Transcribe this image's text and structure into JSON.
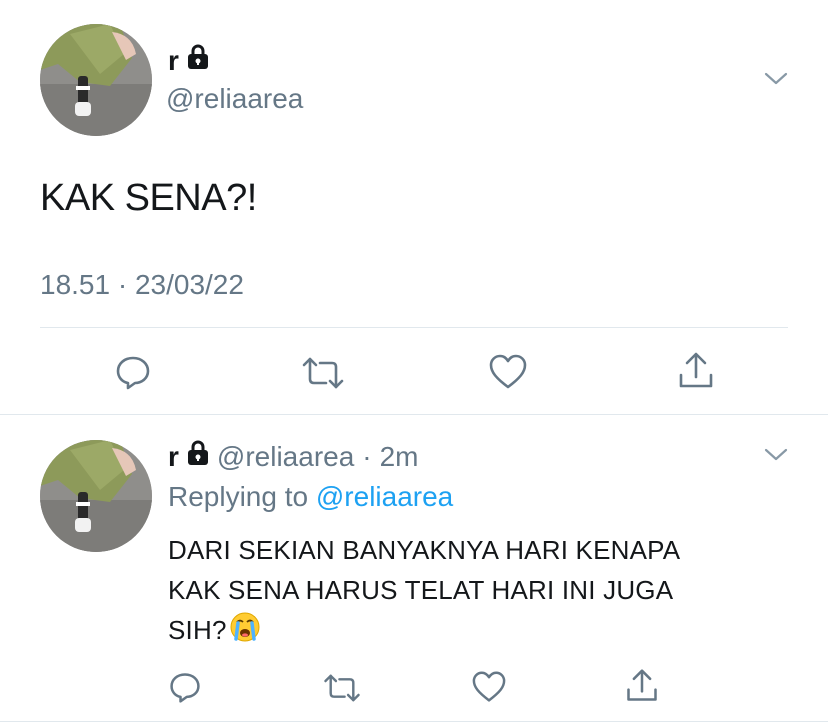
{
  "main_tweet": {
    "display_name": "r",
    "handle": "@reliaarea",
    "text": "KAK SENA?!",
    "timestamp": "18.51 · 23/03/22"
  },
  "reply_tweet": {
    "display_name": "r",
    "handle": "@reliaarea",
    "separator": "·",
    "age": "2m",
    "replying_prefix": "Replying to",
    "replying_handle": "@reliaarea",
    "text_line1": "DARI SEKIAN BANYAKNYA HARI KENAPA",
    "text_line2": "KAK SENA HARUS TELAT HARI INI JUGA",
    "text_line3": "SIH?"
  },
  "icons": {
    "lock": "lock-icon",
    "menu": "chevron-down-icon",
    "reply": "reply-icon",
    "retweet": "retweet-icon",
    "like": "heart-icon",
    "share": "share-icon",
    "emoji": "crying-face-emoji"
  },
  "colors": {
    "text": "#14171a",
    "secondary": "#657786",
    "link": "#1da1f2",
    "divider": "#e1e8ed"
  }
}
